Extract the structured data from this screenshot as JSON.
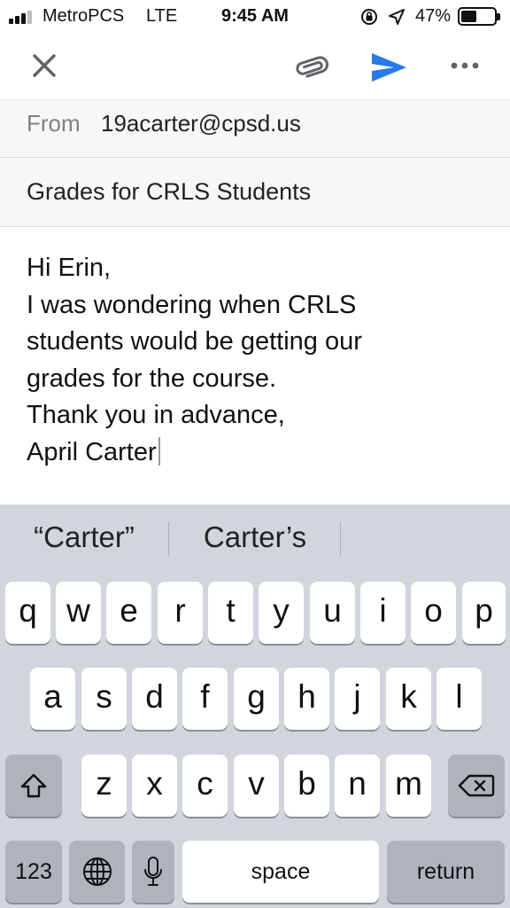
{
  "status_bar": {
    "carrier": "MetroPCS",
    "network": "LTE",
    "time": "9:45 AM",
    "battery_percent": "47%",
    "battery_level": 0.47,
    "signal_bars": 3,
    "icons": [
      "signal-icon",
      "orientation-lock-icon",
      "location-icon",
      "battery-icon"
    ]
  },
  "toolbar": {
    "icons": [
      "close-icon",
      "paperclip-icon",
      "send-icon",
      "more-icon"
    ],
    "accent_color": "#2979e8"
  },
  "email": {
    "from_label": "From",
    "from_value": "19acarter@cpsd.us",
    "subject": "Grades for CRLS Students",
    "body_lines": [
      "Hi Erin,",
      "I was wondering when CRLS",
      "students would be getting our",
      "grades for the course.",
      "",
      "Thank you in advance,",
      "April Carter"
    ]
  },
  "keyboard": {
    "suggestions": [
      "“Carter”",
      "Carter’s",
      ""
    ],
    "rows": [
      [
        "q",
        "w",
        "e",
        "r",
        "t",
        "y",
        "u",
        "i",
        "o",
        "p"
      ],
      [
        "a",
        "s",
        "d",
        "f",
        "g",
        "h",
        "j",
        "k",
        "l"
      ],
      [
        "z",
        "x",
        "c",
        "v",
        "b",
        "n",
        "m"
      ]
    ],
    "numbers_label": "123",
    "space_label": "space",
    "return_label": "return",
    "icons": [
      "shift-icon",
      "backspace-icon",
      "globe-icon",
      "microphone-icon"
    ]
  }
}
